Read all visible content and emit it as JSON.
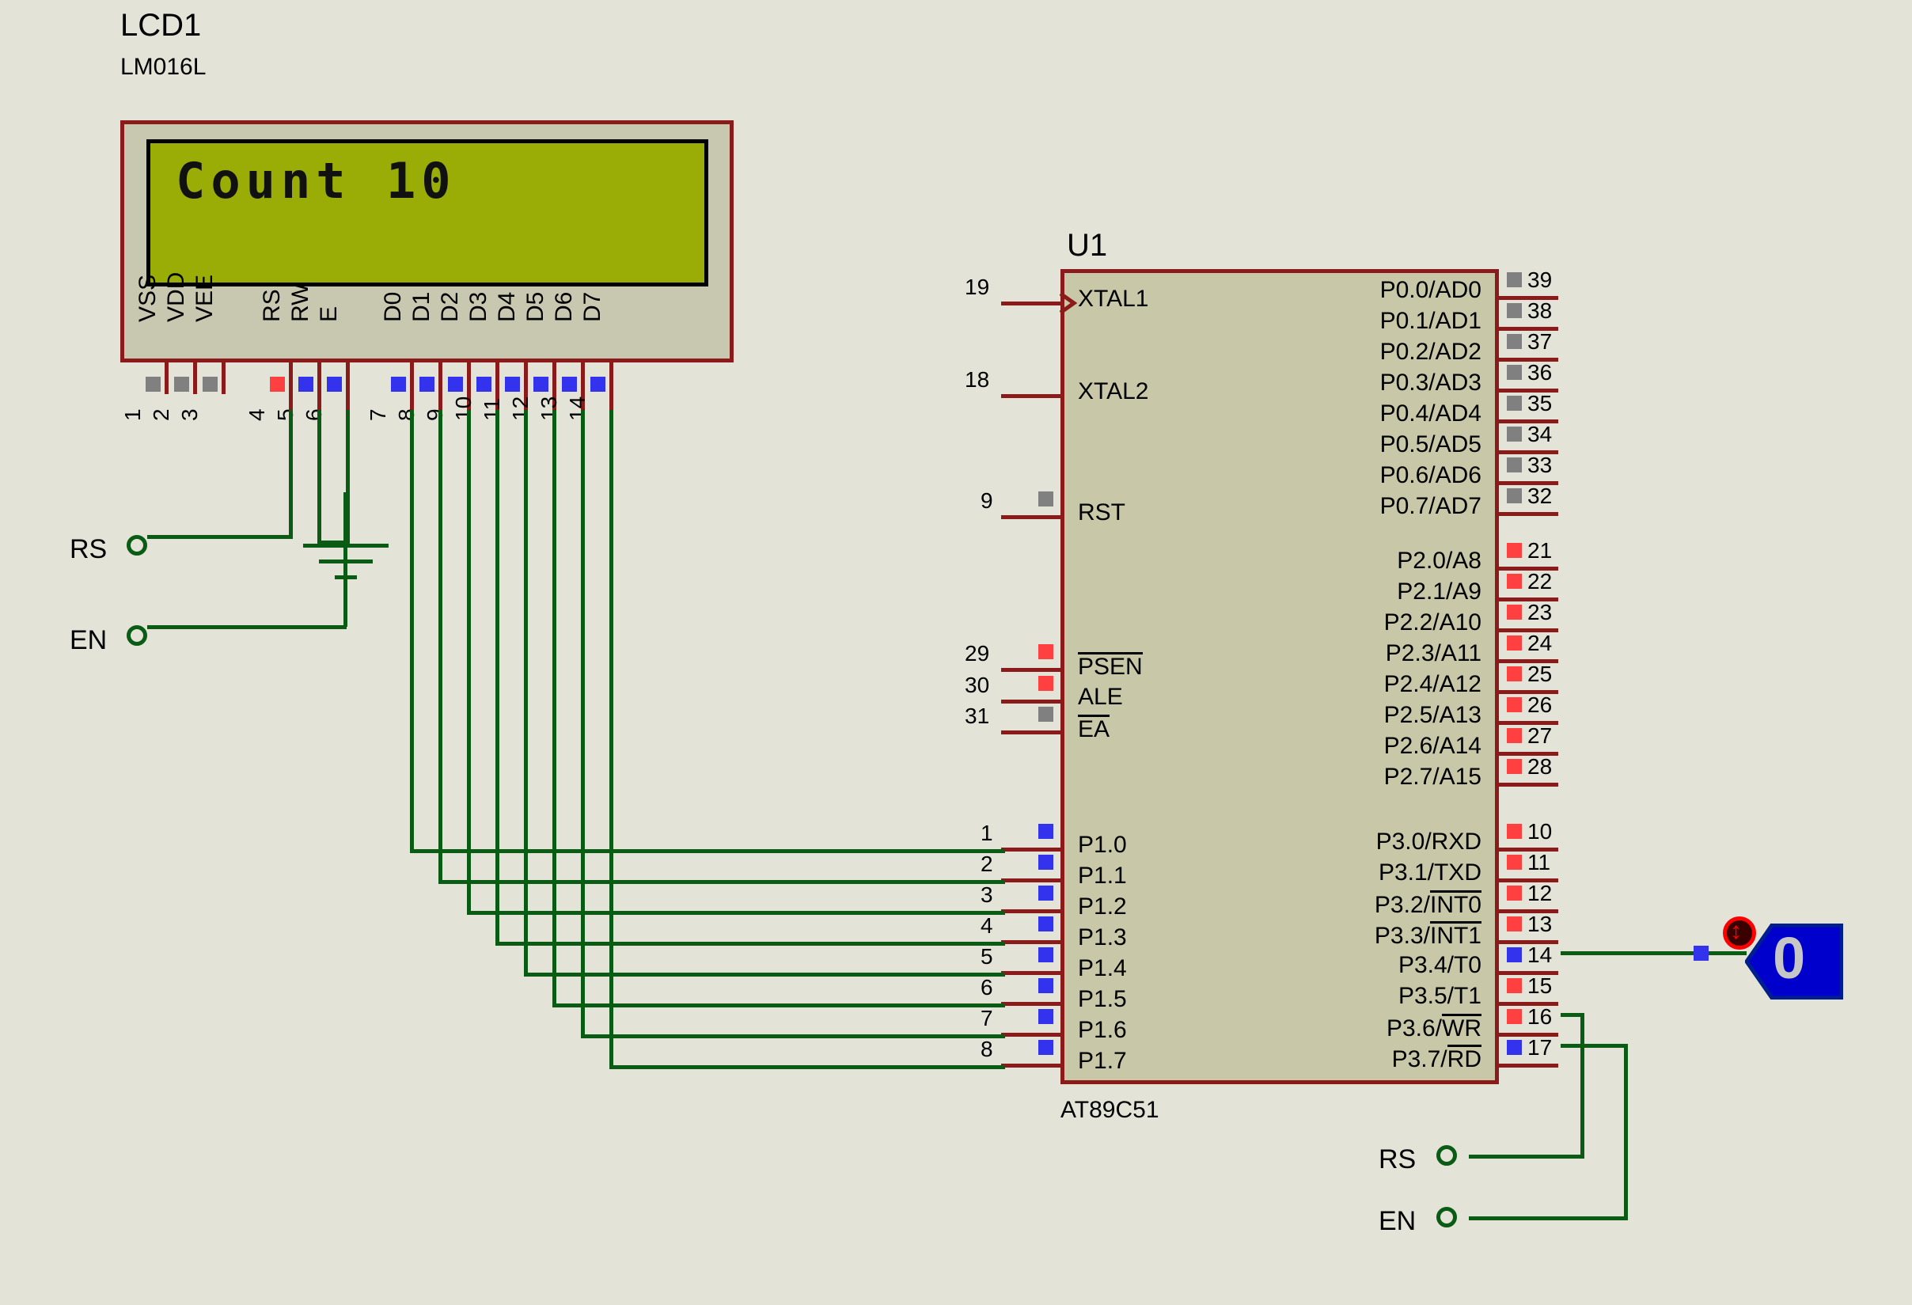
{
  "schematic": {
    "background_color": "#e3e4d7",
    "wire_color": "#0a5c14",
    "body_outline_color": "#8b1a1a"
  },
  "lcd": {
    "reference": "LCD1",
    "part_number": "LM016L",
    "screen_text": "Count 10",
    "screen_color": "#9aad06",
    "pins": [
      {
        "number": "1",
        "label": "VSS",
        "state_color": "#808080"
      },
      {
        "number": "2",
        "label": "VDD",
        "state_color": "#808080"
      },
      {
        "number": "3",
        "label": "VEE",
        "state_color": "#808080"
      },
      {
        "number": "4",
        "label": "RS",
        "state_color": "#ff4040"
      },
      {
        "number": "5",
        "label": "RW",
        "state_color": "#3333ee"
      },
      {
        "number": "6",
        "label": "E",
        "state_color": "#3333ee"
      },
      {
        "number": "7",
        "label": "D0",
        "state_color": "#3333ee"
      },
      {
        "number": "8",
        "label": "D1",
        "state_color": "#3333ee"
      },
      {
        "number": "9",
        "label": "D2",
        "state_color": "#3333ee"
      },
      {
        "number": "10",
        "label": "D3",
        "state_color": "#3333ee"
      },
      {
        "number": "11",
        "label": "D4",
        "state_color": "#3333ee"
      },
      {
        "number": "12",
        "label": "D5",
        "state_color": "#3333ee"
      },
      {
        "number": "13",
        "label": "D6",
        "state_color": "#3333ee"
      },
      {
        "number": "14",
        "label": "D7",
        "state_color": "#3333ee"
      }
    ]
  },
  "mcu": {
    "reference": "U1",
    "part_number": "AT89C51",
    "left_pins": [
      {
        "number": "19",
        "label": "XTAL1",
        "state_color": "none",
        "clock": true
      },
      {
        "number": "18",
        "label": "XTAL2",
        "state_color": "none",
        "clock": false
      },
      {
        "number": "9",
        "label": "RST",
        "state_color": "#808080",
        "clock": false
      },
      {
        "number": "29",
        "label": "PSEN",
        "state_color": "#ff4040",
        "overbar": true
      },
      {
        "number": "30",
        "label": "ALE",
        "state_color": "#ff4040",
        "overbar": false
      },
      {
        "number": "31",
        "label": "EA",
        "state_color": "#808080",
        "overbar": true
      },
      {
        "number": "1",
        "label": "P1.0",
        "state_color": "#3333ee"
      },
      {
        "number": "2",
        "label": "P1.1",
        "state_color": "#3333ee"
      },
      {
        "number": "3",
        "label": "P1.2",
        "state_color": "#3333ee"
      },
      {
        "number": "4",
        "label": "P1.3",
        "state_color": "#3333ee"
      },
      {
        "number": "5",
        "label": "P1.4",
        "state_color": "#3333ee"
      },
      {
        "number": "6",
        "label": "P1.5",
        "state_color": "#3333ee"
      },
      {
        "number": "7",
        "label": "P1.6",
        "state_color": "#3333ee"
      },
      {
        "number": "8",
        "label": "P1.7",
        "state_color": "#3333ee"
      }
    ],
    "right_pins_p0": [
      {
        "number": "39",
        "label": "P0.0/AD0",
        "state_color": "#808080"
      },
      {
        "number": "38",
        "label": "P0.1/AD1",
        "state_color": "#808080"
      },
      {
        "number": "37",
        "label": "P0.2/AD2",
        "state_color": "#808080"
      },
      {
        "number": "36",
        "label": "P0.3/AD3",
        "state_color": "#808080"
      },
      {
        "number": "35",
        "label": "P0.4/AD4",
        "state_color": "#808080"
      },
      {
        "number": "34",
        "label": "P0.5/AD5",
        "state_color": "#808080"
      },
      {
        "number": "33",
        "label": "P0.6/AD6",
        "state_color": "#808080"
      },
      {
        "number": "32",
        "label": "P0.7/AD7",
        "state_color": "#808080"
      }
    ],
    "right_pins_p2": [
      {
        "number": "21",
        "label": "P2.0/A8",
        "state_color": "#ff4040"
      },
      {
        "number": "22",
        "label": "P2.1/A9",
        "state_color": "#ff4040"
      },
      {
        "number": "23",
        "label": "P2.2/A10",
        "state_color": "#ff4040"
      },
      {
        "number": "24",
        "label": "P2.3/A11",
        "state_color": "#ff4040"
      },
      {
        "number": "25",
        "label": "P2.4/A12",
        "state_color": "#ff4040"
      },
      {
        "number": "26",
        "label": "P2.5/A13",
        "state_color": "#ff4040"
      },
      {
        "number": "27",
        "label": "P2.6/A14",
        "state_color": "#ff4040"
      },
      {
        "number": "28",
        "label": "P2.7/A15",
        "state_color": "#ff4040"
      }
    ],
    "right_pins_p3": [
      {
        "number": "10",
        "label": "P3.0/RXD",
        "pre": "P3.0/",
        "bar": "",
        "post": "RXD",
        "state_color": "#ff4040"
      },
      {
        "number": "11",
        "label": "P3.1/TXD",
        "pre": "P3.1/",
        "bar": "",
        "post": "TXD",
        "state_color": "#ff4040"
      },
      {
        "number": "12",
        "label": "P3.2/INT0",
        "pre": "P3.2/",
        "bar": "INT0",
        "post": "",
        "state_color": "#ff4040"
      },
      {
        "number": "13",
        "label": "P3.3/INT1",
        "pre": "P3.3/",
        "bar": "INT1",
        "post": "",
        "state_color": "#ff4040"
      },
      {
        "number": "14",
        "label": "P3.4/T0",
        "pre": "P3.4/",
        "bar": "",
        "post": "T0",
        "state_color": "#3333ee"
      },
      {
        "number": "15",
        "label": "P3.5/T1",
        "pre": "P3.5/",
        "bar": "",
        "post": "T1",
        "state_color": "#ff4040"
      },
      {
        "number": "16",
        "label": "P3.6/WR",
        "pre": "P3.6/",
        "bar": "WR",
        "post": "",
        "state_color": "#ff4040"
      },
      {
        "number": "17",
        "label": "P3.7/RD",
        "pre": "P3.7/",
        "bar": "RD",
        "post": "",
        "state_color": "#3333ee"
      }
    ]
  },
  "terminals": {
    "left_rs": "RS",
    "left_en": "EN",
    "right_rs": "RS",
    "right_en": "EN"
  },
  "logic_probe": {
    "value": "0",
    "body_color": "#0000cc",
    "digit_color": "#c6c6c6",
    "toggle_icon": "up-down-arrow"
  }
}
